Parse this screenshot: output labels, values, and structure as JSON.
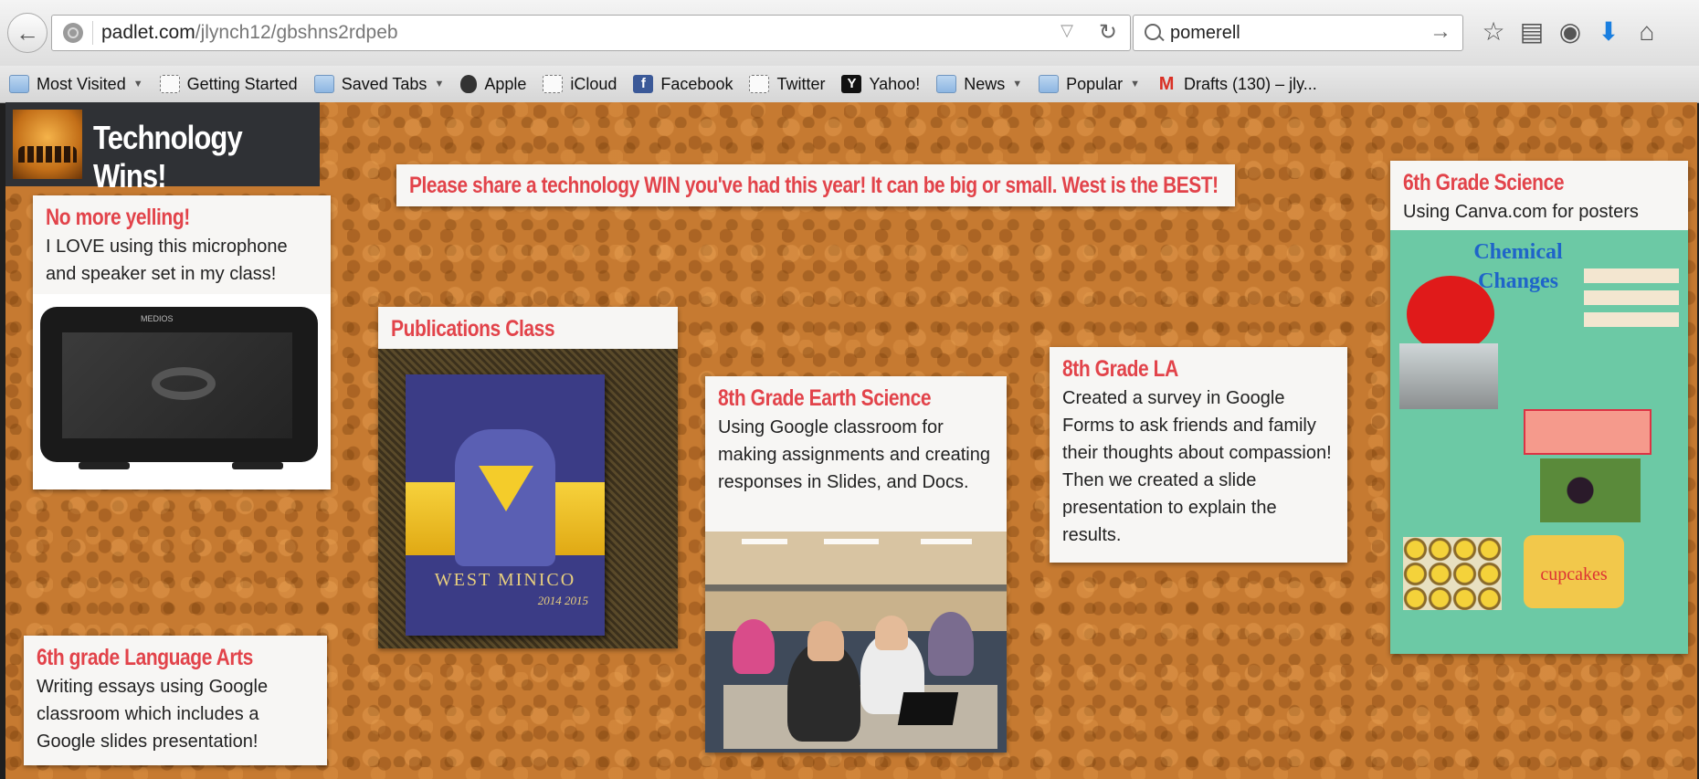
{
  "browser": {
    "url_domain": "padlet.com",
    "url_path": "/jlynch12/gbshns2rdpeb",
    "search_value": "pomerell",
    "bookmarks": [
      {
        "label": "Most Visited",
        "icon": "folder-icon",
        "dropdown": true
      },
      {
        "label": "Getting Started",
        "icon": "page-icon",
        "dropdown": false
      },
      {
        "label": "Saved Tabs",
        "icon": "folder-icon",
        "dropdown": true
      },
      {
        "label": "Apple",
        "icon": "apple-icon",
        "dropdown": false
      },
      {
        "label": "iCloud",
        "icon": "page-icon",
        "dropdown": false
      },
      {
        "label": "Facebook",
        "icon": "facebook-icon",
        "dropdown": false
      },
      {
        "label": "Twitter",
        "icon": "page-icon",
        "dropdown": false
      },
      {
        "label": "Yahoo!",
        "icon": "yahoo-icon",
        "dropdown": false
      },
      {
        "label": "News",
        "icon": "folder-icon",
        "dropdown": true
      },
      {
        "label": "Popular",
        "icon": "folder-icon",
        "dropdown": true
      },
      {
        "label": "Drafts (130) – jly...",
        "icon": "gmail-icon",
        "dropdown": false
      }
    ]
  },
  "board": {
    "title": "Technology Wins!",
    "banner": "Please share a technology WIN you've had this year! It can be big or small. West is the BEST!",
    "posts": [
      {
        "title": "No more yelling!",
        "body": "I LOVE using this microphone and speaker set in my class!"
      },
      {
        "title": "Publications Class",
        "body": ""
      },
      {
        "title": "8th Grade Earth Science",
        "body": "Using Google classroom for making assignments and creating responses in Slides, and Docs."
      },
      {
        "title": "8th Grade LA",
        "body": "Created a survey in Google Forms to ask friends and family their thoughts about compassion!  Then we created a slide presentation to explain the results."
      },
      {
        "title": "6th Grade Science",
        "body": "Using Canva.com for posters"
      },
      {
        "title": "6th grade Language Arts",
        "body": "Writing essays using Google classroom which includes a Google slides presentation!"
      }
    ],
    "image_texts": {
      "tablet_brand": "MEDIOS",
      "yearbook_title": "WEST MINICO",
      "yearbook_year": "2014 2015",
      "canva_title": "Chemical Changes",
      "canva_cupcakes": "cupcakes"
    }
  },
  "colors": {
    "post_title": "#e2434a",
    "cork": "#c67a31",
    "brand_bar": "#2f3135",
    "canva_bg": "#6cc9a5"
  }
}
